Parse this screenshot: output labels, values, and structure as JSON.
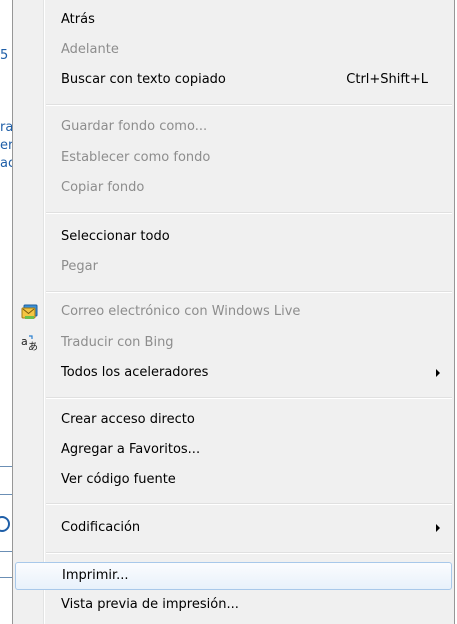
{
  "background": {
    "fragments": [
      "5",
      "ra",
      "er",
      "ac"
    ]
  },
  "menu": {
    "items": [
      {
        "label": "Atrás",
        "shortcut": "",
        "disabled": false,
        "submenu": false
      },
      {
        "label": "Adelante",
        "shortcut": "",
        "disabled": true,
        "submenu": false
      },
      {
        "label": "Buscar con texto copiado",
        "shortcut": "Ctrl+Shift+L",
        "disabled": false,
        "submenu": false
      },
      {
        "label": "Guardar fondo como...",
        "shortcut": "",
        "disabled": true,
        "submenu": false
      },
      {
        "label": "Establecer como fondo",
        "shortcut": "",
        "disabled": true,
        "submenu": false
      },
      {
        "label": "Copiar fondo",
        "shortcut": "",
        "disabled": true,
        "submenu": false
      },
      {
        "label": "Seleccionar todo",
        "shortcut": "",
        "disabled": false,
        "submenu": false
      },
      {
        "label": "Pegar",
        "shortcut": "",
        "disabled": true,
        "submenu": false
      },
      {
        "label": "Correo electrónico con Windows Live",
        "shortcut": "",
        "disabled": true,
        "submenu": false,
        "icon": "windows-live-mail-icon"
      },
      {
        "label": "Traducir con Bing",
        "shortcut": "",
        "disabled": true,
        "submenu": false,
        "icon": "translate-icon"
      },
      {
        "label": "Todos los aceleradores",
        "shortcut": "",
        "disabled": false,
        "submenu": true
      },
      {
        "label": "Crear acceso directo",
        "shortcut": "",
        "disabled": false,
        "submenu": false
      },
      {
        "label": "Agregar a Favoritos...",
        "shortcut": "",
        "disabled": false,
        "submenu": false
      },
      {
        "label": "Ver código fuente",
        "shortcut": "",
        "disabled": false,
        "submenu": false
      },
      {
        "label": "Codificación",
        "shortcut": "",
        "disabled": false,
        "submenu": true
      },
      {
        "label": "Imprimir...",
        "shortcut": "",
        "disabled": false,
        "submenu": false,
        "highlighted": true
      },
      {
        "label": "Vista previa de impresión...",
        "shortcut": "",
        "disabled": false,
        "submenu": false
      }
    ]
  },
  "colors": {
    "menu_background": "#f0f0f0",
    "disabled_text": "#8d8d8d",
    "highlight_border": "#a8c8ea",
    "link_blue": "#1f5fa8"
  }
}
